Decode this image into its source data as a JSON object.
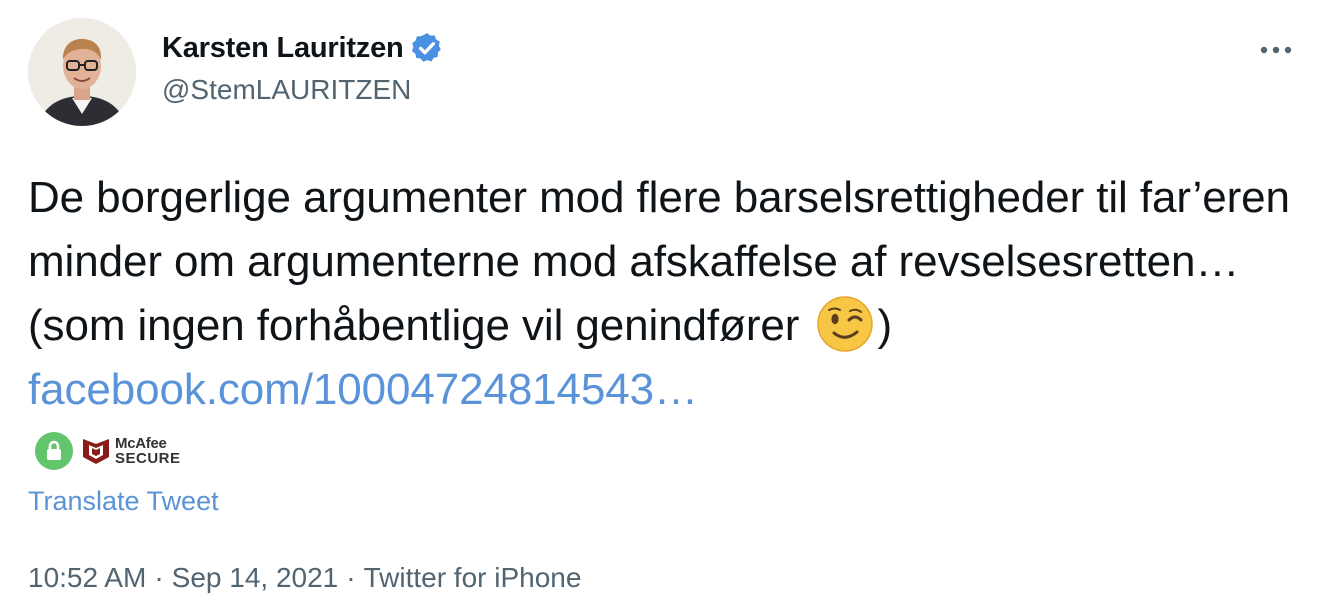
{
  "author": {
    "name": "Karsten Lauritzen",
    "handle": "@StemLAURITZEN",
    "verified": true
  },
  "tweet": {
    "text_before_emoji": "De borgerlige argumenter mod flere barselsrettigheder til far’eren minder om argumenterne mod afskaffelse af revselsesretten…(som ingen forhåbentlige vil genindfører",
    "emoji": "winking-face",
    "text_after_emoji": ")",
    "link_text": "facebook.com/10004724814543…"
  },
  "badges": {
    "lock_icon": "lock-icon",
    "mcafee_name": "McAfee",
    "mcafee_secure": "SECURE"
  },
  "translate_label": "Translate Tweet",
  "meta": {
    "time": "10:52 AM",
    "date": "Sep 14, 2021",
    "source": "Twitter for iPhone",
    "separator": "·"
  },
  "colors": {
    "link": "#5b93d8",
    "verified": "#4a90e2",
    "secondary_text": "#536471",
    "lock_badge": "#62c46b",
    "mcafee_red": "#8b1a1a"
  }
}
